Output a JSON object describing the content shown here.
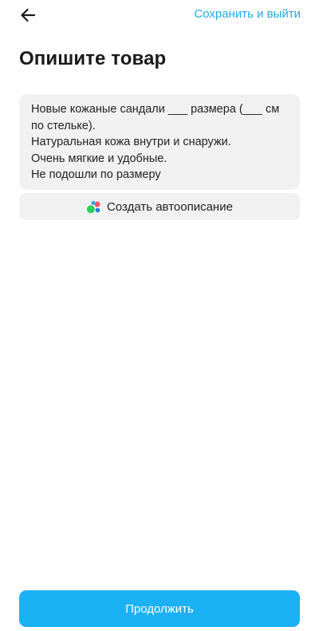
{
  "header": {
    "back_icon": "arrow-left-icon",
    "save_exit_label": "Сохранить и выйти",
    "accent_color": "#23a9e8"
  },
  "page": {
    "title": "Опишите товар"
  },
  "description": {
    "lines": [
      "Новые кожаные сандали ___ размера (___ см",
      "по стельке).",
      "Натуральная кожа внутри и снаружи.",
      "Очень мягкие и удобные.",
      "Не подошли по размеру"
    ]
  },
  "auto_description": {
    "icon": "colored-dots-icon",
    "label": "Создать автоописание"
  },
  "footer": {
    "continue_label": "Продолжить",
    "button_color": "#1bb1f5"
  }
}
